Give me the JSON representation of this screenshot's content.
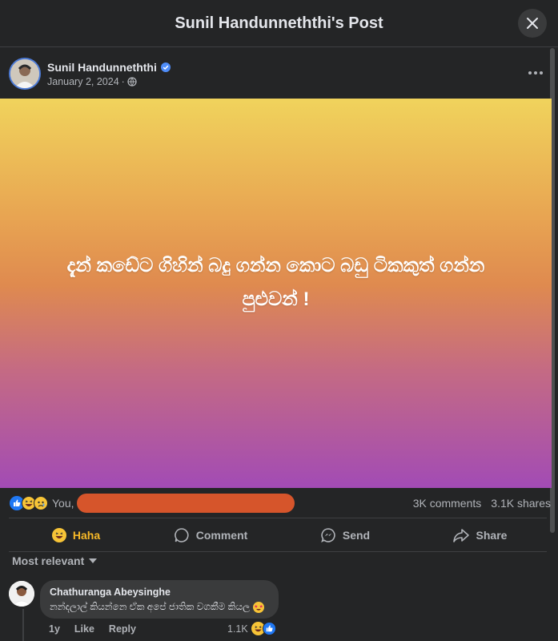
{
  "modal": {
    "title": "Sunil Handunneththi's Post"
  },
  "post": {
    "author": "Sunil Handunneththi",
    "date": "January 2, 2024",
    "separator": "·",
    "text_line1": "දැන් කඩේට ගිහින් බදු ගන්න කොට බඩු ටිකකුත් ගන්න",
    "text_line2": "පුළුවන් !"
  },
  "reactions": {
    "you_label": "You,",
    "comments": "3K comments",
    "shares": "3.1K shares"
  },
  "actions": {
    "haha": "Haha",
    "comment": "Comment",
    "send": "Send",
    "share": "Share"
  },
  "sort": {
    "label": "Most relevant"
  },
  "comment": {
    "author": "Chathuranga Abeysinghe",
    "text": "නන්දලාල් කියන්නෙ ඒක අපේ ජාතික වගකීම කියල",
    "age": "1y",
    "like": "Like",
    "reply": "Reply",
    "reaction_count": "1.1K"
  },
  "colors": {
    "background": "#242526",
    "accent_haha": "#f7b928",
    "like_blue": "#2078f4",
    "redaction": "#d6552b"
  }
}
